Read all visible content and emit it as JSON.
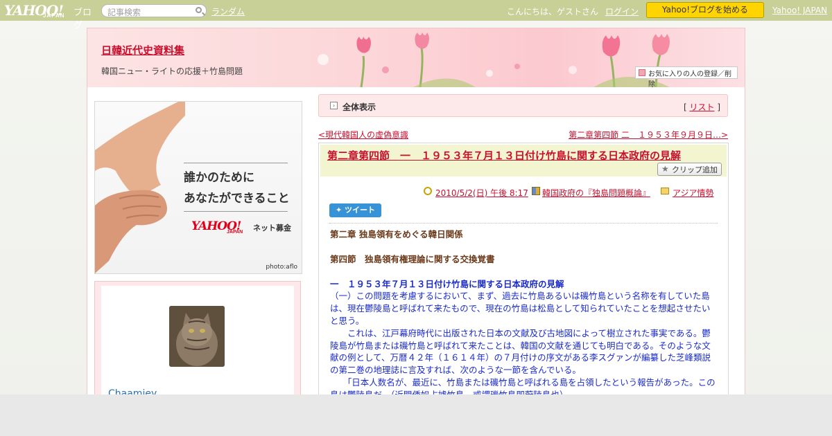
{
  "topbar": {
    "logo_text": "YAHOO!",
    "logo_sub": "JAPAN",
    "logo_blog": "ブログ",
    "search_placeholder": "記事検索",
    "random_link": "ランダム",
    "greeting": "こんにちは、ゲストさん",
    "login": "ログイン",
    "start_button": "Yahoo!ブログを始める",
    "yahoo_japan": "Yahoo! JAPAN"
  },
  "header": {
    "title": "日韓近代史資料集",
    "subtitle": "韓国ニュー・ライトの応援＋竹島問題",
    "fav_button": "お気に入りの人の登録／削除"
  },
  "banner": {
    "line1": "誰かのために",
    "line2": "あなたができること",
    "logo": "YAHOO!",
    "logo_sub": "JAPAN",
    "donate": "ネット募金",
    "photo_credit": "photo:aflo"
  },
  "profile": {
    "username": "Chaamiey"
  },
  "showall": {
    "label": "全体表示",
    "list_link": "リスト",
    "bracket_open": "[",
    "bracket_close": "]"
  },
  "nav": {
    "prev": "<現代韓国人の虚偽意識",
    "next": "第二章第四節 二　１９５３年９月９日…>"
  },
  "article": {
    "title": "第二章第四節　一　１９５３年７月１３日付け竹島に関する日本政府の見解",
    "clip_button": "クリップ追加",
    "date": "2010/5/2(日) 午後 8:17",
    "book": "韓国政府の『独島問題概論』",
    "category": "アジア情勢",
    "tweet": "ツイート",
    "body": {
      "chapter": "第二章 独島領有をめぐる韓日関係",
      "section": "第四節　独島領有権理論に関する交換覚書",
      "heading": "一　１９５３年７月１３日付け竹島に関する日本政府の見解",
      "p1": "（一）この問題を考慮するにおいて、まず、過去に竹島あるいは磯竹島という名称を有していた島は、現在鬱陵島と呼ばれて来たもので、現在の竹島は松島として知られていたことを想起させたいと思う。",
      "p2": "　　これは、江戸幕府時代に出版された日本の文献及び古地図によって樹立された事実である。鬱陵島が竹島または磯竹島と呼ばれて来たことは、韓国の文献を通じても明白である。そのような文献の例として、万暦４２年（１６１４年）の７月付けの序文がある李スグァンが編纂した芝峰類説の第二巻の地理誌に言及すれば、次のような一節を含んでいる。",
      "p3": "　　「日本人数名が、最近に、竹島または磯竹島と呼ばれる島を占領したという報告があった。この島は鬱陵島だ。（近聞倭奴占據竹島　或謂磯竹島即蔚陵島也）"
    }
  }
}
